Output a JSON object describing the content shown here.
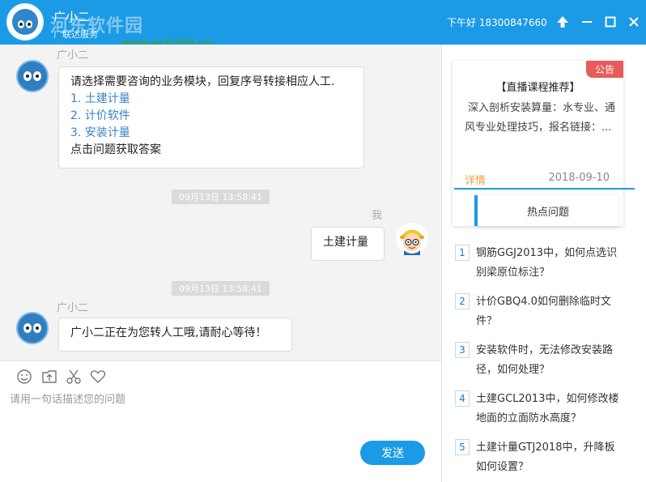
{
  "window": {
    "title": "广小二",
    "subtitle": "广联达服务",
    "status": "下午好 18300847660",
    "watermark": "河东软件园",
    "watermark_url": "www.pc0359.cn"
  },
  "chat": {
    "messages": [
      {
        "sender": "广小二",
        "intro": "请选择需要咨询的业务模块，回复序号转接相应人工.",
        "options": [
          "1. 土建计量",
          "2. 计价软件",
          "3. 安装计量"
        ],
        "outro": "点击问题获取答案"
      },
      {
        "timestamp": "09月13日 13:58:41"
      },
      {
        "sender": "我",
        "text": "土建计量"
      },
      {
        "timestamp": "09月13日 13:58:41"
      },
      {
        "sender": "广小二",
        "text": "广小二正在为您转人工哦,请耐心等待！"
      }
    ]
  },
  "composer": {
    "tools": [
      "smile-icon",
      "upload-icon",
      "scissors-icon",
      "heart-icon"
    ],
    "placeholder": "请用一句话描述您的问题",
    "send_label": "发送"
  },
  "notice": {
    "badge": "公告",
    "title": "【直播课程推荐】",
    "body": "深入剖析安装算量：水专业、通风专业处理技巧，报名链接：...",
    "detail_label": "详情",
    "date": "2018-09-10"
  },
  "hot": {
    "tab_label": "热点问题",
    "items": [
      {
        "num": "1",
        "text": "钢筋GGJ2013中，如何点选识别梁原位标注？"
      },
      {
        "num": "2",
        "text": "计价GBQ4.0如何删除临时文件？"
      },
      {
        "num": "3",
        "text": "安装软件时，无法修改安装路径，如何处理？"
      },
      {
        "num": "4",
        "text": "土建GCL2013中，如何修改楼地面的立面防水高度？"
      },
      {
        "num": "5",
        "text": "土建计量GTJ2018中，升降板如何设置？"
      }
    ]
  },
  "colors": {
    "accent": "#1b9ae6",
    "badge": "#e85b5b",
    "detail": "#f0a040",
    "link": "#3a83c4"
  }
}
